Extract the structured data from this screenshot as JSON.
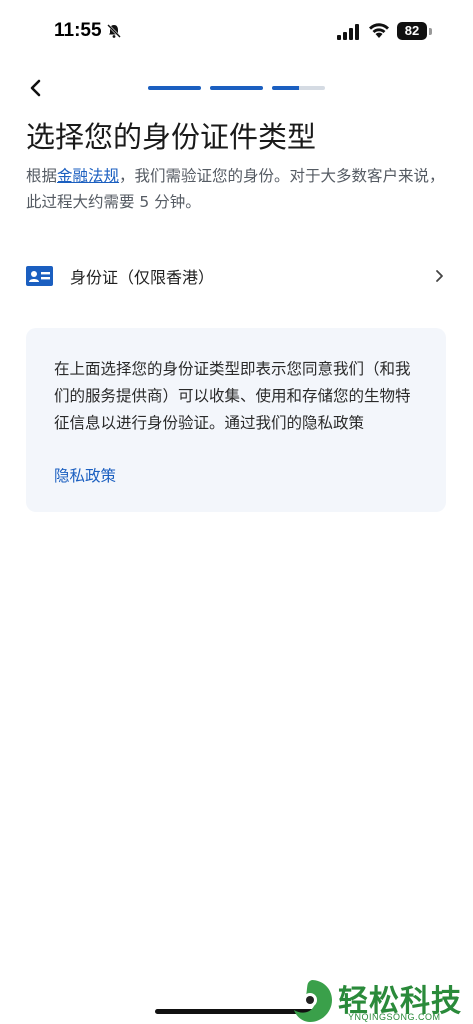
{
  "status_bar": {
    "time": "11:55",
    "battery": "82"
  },
  "progress": {
    "steps": [
      1,
      1,
      0.5
    ]
  },
  "page": {
    "title": "选择您的身份证件类型",
    "subtitle_prefix": "根据",
    "subtitle_link": "金融法规",
    "subtitle_suffix": "，我们需验证您的身份。对于大多数客户来说，此过程大约需要 5 分钟。"
  },
  "id_option": {
    "label": "身份证（仅限香港）",
    "icon": "id-card-icon"
  },
  "notice": {
    "text": "在上面选择您的身份证类型即表示您同意我们（和我们的服务提供商）可以收集、使用和存储您的生物特征信息以进行身份验证。通过我们的隐私政策",
    "link": "隐私政策"
  },
  "watermark": {
    "brand": "轻松科技",
    "url": "YNQINGSONG.COM"
  },
  "colors": {
    "accent": "#1b5fc0",
    "card_bg": "#f3f6fb",
    "track": "#d5dbe3"
  }
}
